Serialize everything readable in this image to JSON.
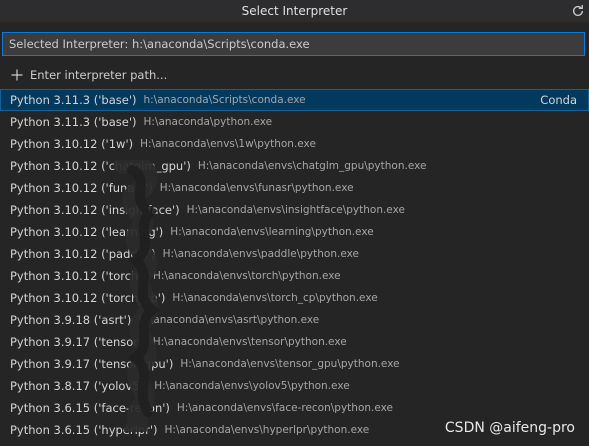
{
  "title": "Select Interpreter",
  "input": {
    "placeholder": "Selected Interpreter: h:\\anaconda\\Scripts\\conda.exe"
  },
  "enter_path_label": "Enter interpreter path...",
  "icons": {
    "refresh": "refresh-icon",
    "add": "plus-icon"
  },
  "colors": {
    "background": "#252526",
    "selected": "#04395e",
    "focus_border": "#0e7ad4"
  },
  "interpreters": [
    {
      "label": "Python 3.11.3 ('base')",
      "description": "h:\\anaconda\\Scripts\\conda.exe",
      "detail": "Conda",
      "selected": true
    },
    {
      "label": "Python 3.11.3 ('base')",
      "description": "H:\\anaconda\\python.exe",
      "detail": ""
    },
    {
      "label": "Python 3.10.12 ('1w')",
      "description": "H:\\anaconda\\envs\\1w\\python.exe",
      "detail": ""
    },
    {
      "label": "Python 3.10.12 ('chatglm_gpu')",
      "description": "H:\\anaconda\\envs\\chatglm_gpu\\python.exe",
      "detail": ""
    },
    {
      "label": "Python 3.10.12 ('funasr')",
      "description": "H:\\anaconda\\envs\\funasr\\python.exe",
      "detail": ""
    },
    {
      "label": "Python 3.10.12 ('insightface')",
      "description": "H:\\anaconda\\envs\\insightface\\python.exe",
      "detail": ""
    },
    {
      "label": "Python 3.10.12 ('learning')",
      "description": "H:\\anaconda\\envs\\learning\\python.exe",
      "detail": ""
    },
    {
      "label": "Python 3.10.12 ('paddle')",
      "description": "H:\\anaconda\\envs\\paddle\\python.exe",
      "detail": ""
    },
    {
      "label": "Python 3.10.12 ('torch')",
      "description": "H:\\anaconda\\envs\\torch\\python.exe",
      "detail": ""
    },
    {
      "label": "Python 3.10.12 ('torch_cp')",
      "description": "H:\\anaconda\\envs\\torch_cp\\python.exe",
      "detail": ""
    },
    {
      "label": "Python 3.9.18 ('asrt')",
      "description": "H:\\anaconda\\envs\\asrt\\python.exe",
      "detail": ""
    },
    {
      "label": "Python 3.9.17 ('tensor')",
      "description": "H:\\anaconda\\envs\\tensor\\python.exe",
      "detail": ""
    },
    {
      "label": "Python 3.9.17 ('tensor_gpu')",
      "description": "H:\\anaconda\\envs\\tensor_gpu\\python.exe",
      "detail": ""
    },
    {
      "label": "Python 3.8.17 ('yolov5')",
      "description": "H:\\anaconda\\envs\\yolov5\\python.exe",
      "detail": ""
    },
    {
      "label": "Python 3.6.15 ('face-recon')",
      "description": "H:\\anaconda\\envs\\face-recon\\python.exe",
      "detail": ""
    },
    {
      "label": "Python 3.6.15 ('hyperlpr')",
      "description": "H:\\anaconda\\envs\\hyperlpr\\python.exe",
      "detail": ""
    }
  ],
  "watermark": "CSDN @aifeng-pro"
}
